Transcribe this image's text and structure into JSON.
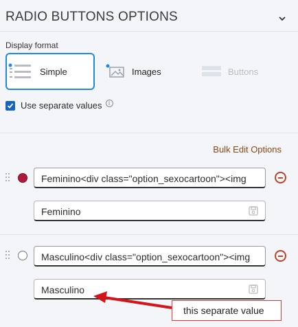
{
  "section": {
    "title": "RADIO BUTTONS OPTIONS"
  },
  "display_format": {
    "label": "Display format",
    "options": [
      {
        "label": "Simple",
        "icon": "list-icon",
        "selected": true
      },
      {
        "label": "Images",
        "icon": "image-icon",
        "selected": false
      },
      {
        "label": "Buttons",
        "icon": "buttons-icon",
        "selected": false,
        "disabled": true
      }
    ]
  },
  "separate_values": {
    "label": "Use separate values",
    "checked": true,
    "info_icon": "info-icon"
  },
  "bulk_edit": {
    "label": "Bulk Edit Options"
  },
  "options": [
    {
      "text": "Feminino<div class=\"option_sexocartoon\"><img",
      "value": "Feminino",
      "selected": true
    },
    {
      "text": "Masculino<div class=\"option_sexocartoon\"><img",
      "value": "Masculino",
      "selected": false
    }
  ],
  "annotation": {
    "text": "this separate value"
  },
  "colors": {
    "accent": "#1e88e5",
    "checkbox": "#1565c0",
    "selected_radio": "#b01a3a",
    "remove": "#b5452b",
    "link": "#8b4513",
    "annotation": "#e53935"
  }
}
